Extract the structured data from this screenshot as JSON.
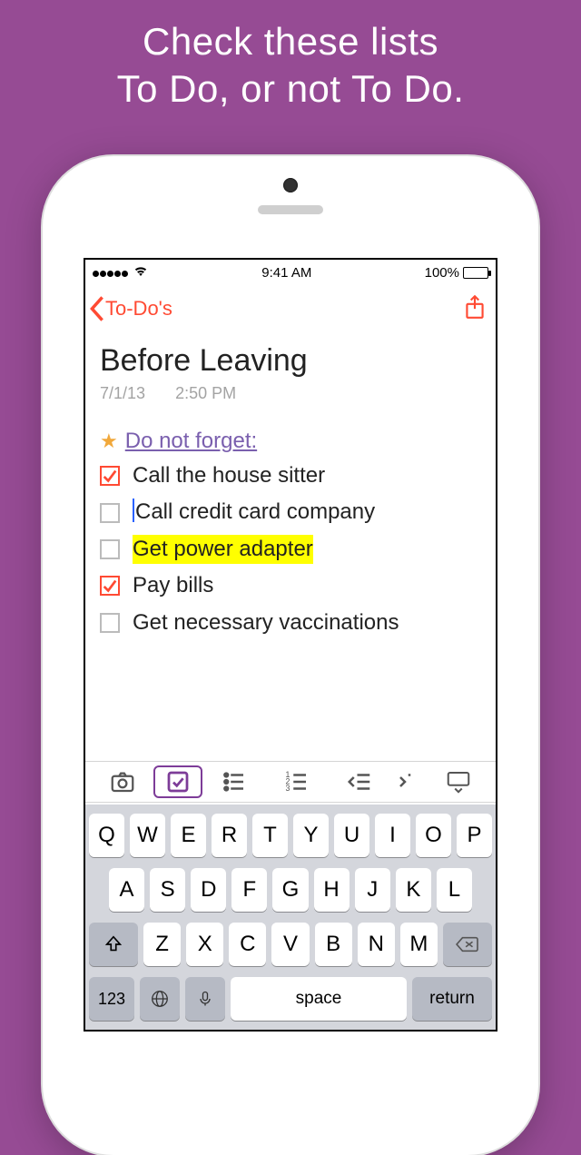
{
  "promo": {
    "line1": "Check these lists",
    "line2": "To Do, or not To Do."
  },
  "statusbar": {
    "time": "9:41 AM",
    "battery_pct": "100%"
  },
  "nav": {
    "back_label": "To-Do's"
  },
  "note": {
    "title": "Before Leaving",
    "date": "7/1/13",
    "time": "2:50 PM",
    "heading": "Do not forget:",
    "items": [
      {
        "text": "Call the house sitter",
        "checked": true,
        "highlight": false,
        "cursor": false
      },
      {
        "text": "Call credit card company",
        "checked": false,
        "highlight": false,
        "cursor": true
      },
      {
        "text": "Get power adapter",
        "checked": false,
        "highlight": true,
        "cursor": false
      },
      {
        "text": "Pay bills",
        "checked": true,
        "highlight": false,
        "cursor": false
      },
      {
        "text": "Get necessary vaccinations",
        "checked": false,
        "highlight": false,
        "cursor": false
      }
    ]
  },
  "keyboard": {
    "rows": [
      [
        "Q",
        "W",
        "E",
        "R",
        "T",
        "Y",
        "U",
        "I",
        "O",
        "P"
      ],
      [
        "A",
        "S",
        "D",
        "F",
        "G",
        "H",
        "J",
        "K",
        "L"
      ],
      [
        "Z",
        "X",
        "C",
        "V",
        "B",
        "N",
        "M"
      ]
    ],
    "numeric_label": "123",
    "space_label": "space",
    "return_label": "return"
  }
}
